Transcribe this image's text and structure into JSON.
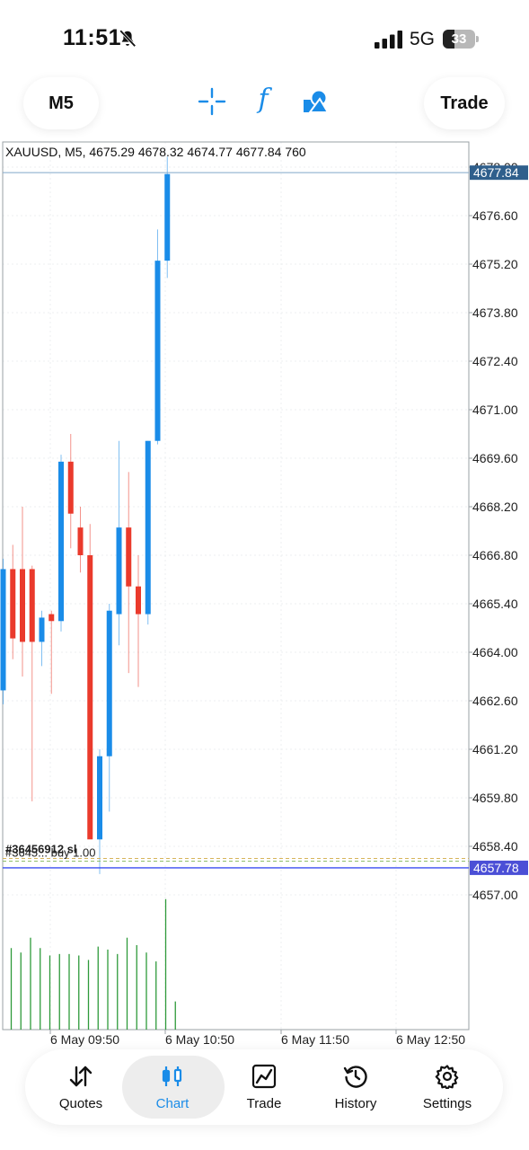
{
  "status": {
    "time": "11:51",
    "network": "5G",
    "battery": "33",
    "icons": [
      "bell-slash-icon",
      "signal-icon",
      "battery-icon"
    ]
  },
  "toolbar": {
    "timeframe_label": "M5",
    "trade_label": "Trade",
    "icons": [
      "crosshair-icon",
      "function-icon",
      "objects-icon"
    ],
    "function_glyph": "f"
  },
  "colors": {
    "accent": "#1a8ce8",
    "bull": "#1a8ce8",
    "bear": "#ea3a2c",
    "volume": "#2e9a3a",
    "bid_line": "#3b4ef0",
    "last_label_bg": "#2f5f8c"
  },
  "chart_data": {
    "type": "candlestick",
    "symbol_info": "XAUUSD, M5, 4675.29 4678.32 4674.77 4677.84 760",
    "price_labels": [
      "4678.00",
      "4676.60",
      "4675.20",
      "4673.80",
      "4672.40",
      "4671.00",
      "4669.60",
      "4668.20",
      "4666.80",
      "4665.40",
      "4664.00",
      "4662.60",
      "4661.20",
      "4659.80",
      "4658.40",
      "4657.00"
    ],
    "time_labels": [
      "6 May 09:50",
      "6 May 10:50",
      "6 May 11:50",
      "6 May 12:50"
    ],
    "current_price_label": "4677.84",
    "bid_price_label": "4657.78",
    "order_label": "#3645... buy 1.00",
    "sl_label": "#36456912 sl",
    "order_price": 4658.05,
    "ylim": [
      4656.9,
      4679.4
    ],
    "candles": [
      {
        "o": 4662.9,
        "h": 4666.7,
        "l": 4662.5,
        "c": 4666.4
      },
      {
        "o": 4666.4,
        "h": 4667.1,
        "l": 4663.8,
        "c": 4664.4
      },
      {
        "o": 4666.4,
        "h": 4668.2,
        "l": 4663.3,
        "c": 4664.3
      },
      {
        "o": 4666.4,
        "h": 4666.5,
        "l": 4659.7,
        "c": 4664.3
      },
      {
        "o": 4664.3,
        "h": 4665.2,
        "l": 4663.6,
        "c": 4665.0
      },
      {
        "o": 4665.1,
        "h": 4665.2,
        "l": 4662.8,
        "c": 4664.9
      },
      {
        "o": 4664.9,
        "h": 4669.7,
        "l": 4664.6,
        "c": 4669.5
      },
      {
        "o": 4669.5,
        "h": 4670.3,
        "l": 4667.0,
        "c": 4668.0
      },
      {
        "o": 4667.6,
        "h": 4668.2,
        "l": 4666.3,
        "c": 4666.8
      },
      {
        "o": 4666.8,
        "h": 4667.7,
        "l": 4661.6,
        "c": 4658.6
      },
      {
        "o": 4658.6,
        "h": 4661.2,
        "l": 4657.6,
        "c": 4661.0
      },
      {
        "o": 4661.0,
        "h": 4665.4,
        "l": 4659.4,
        "c": 4665.2
      },
      {
        "o": 4665.1,
        "h": 4670.1,
        "l": 4664.2,
        "c": 4667.6
      },
      {
        "o": 4667.6,
        "h": 4669.2,
        "l": 4663.4,
        "c": 4665.9
      },
      {
        "o": 4665.9,
        "h": 4666.8,
        "l": 4663.0,
        "c": 4665.1
      },
      {
        "o": 4665.1,
        "h": 4670.1,
        "l": 4664.8,
        "c": 4670.1
      },
      {
        "o": 4670.1,
        "h": 4676.2,
        "l": 4670.0,
        "c": 4675.3
      },
      {
        "o": 4675.3,
        "h": 4678.3,
        "l": 4674.8,
        "c": 4677.8
      }
    ],
    "volumes": [
      55,
      52,
      62,
      55,
      50,
      51,
      51,
      50,
      47,
      56,
      54,
      51,
      62,
      57,
      52,
      46,
      88,
      19
    ],
    "grid": true
  },
  "nav": {
    "items": [
      {
        "label": "Quotes",
        "icon": "quotes-icon"
      },
      {
        "label": "Chart",
        "icon": "chart-icon"
      },
      {
        "label": "Trade",
        "icon": "trade-icon"
      },
      {
        "label": "History",
        "icon": "history-icon"
      },
      {
        "label": "Settings",
        "icon": "settings-icon"
      }
    ],
    "active": "Chart"
  }
}
